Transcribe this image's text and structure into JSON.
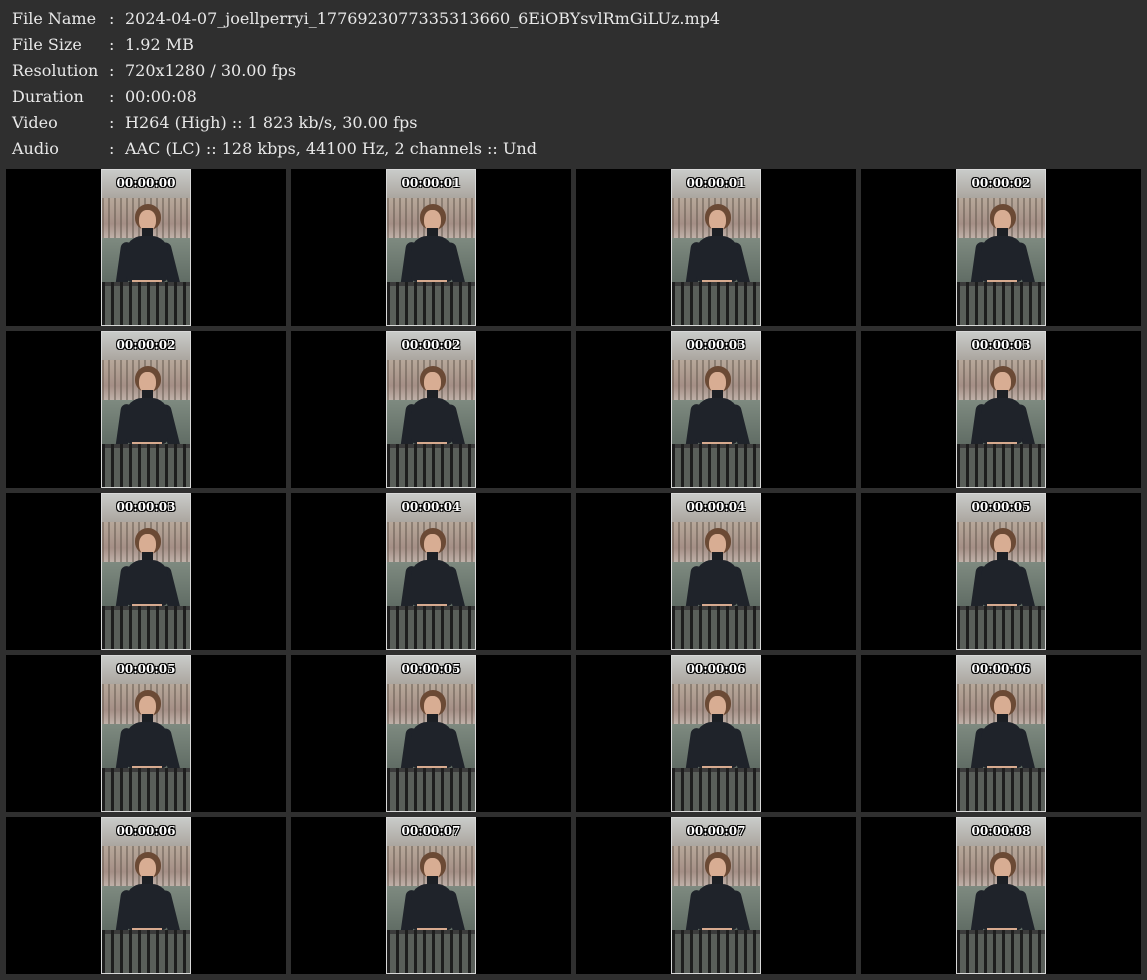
{
  "info": [
    {
      "label": "File Name",
      "value": "2024-04-07_joellperryi_1776923077335313660_6EiOBYsvlRmGiLUz.mp4"
    },
    {
      "label": "File Size",
      "value": "1.92 MB"
    },
    {
      "label": "Resolution",
      "value": "720x1280 / 30.00 fps"
    },
    {
      "label": "Duration",
      "value": "00:00:08"
    },
    {
      "label": "Video",
      "value": "H264 (High) :: 1 823 kb/s, 30.00 fps"
    },
    {
      "label": "Audio",
      "value": "AAC (LC) :: 128 kbps, 44100 Hz, 2 channels :: Und"
    }
  ],
  "colon": ":",
  "thumbnails": [
    {
      "timestamp": "00:00:00"
    },
    {
      "timestamp": "00:00:01"
    },
    {
      "timestamp": "00:00:01"
    },
    {
      "timestamp": "00:00:02"
    },
    {
      "timestamp": "00:00:02"
    },
    {
      "timestamp": "00:00:02"
    },
    {
      "timestamp": "00:00:03"
    },
    {
      "timestamp": "00:00:03"
    },
    {
      "timestamp": "00:00:03"
    },
    {
      "timestamp": "00:00:04"
    },
    {
      "timestamp": "00:00:04"
    },
    {
      "timestamp": "00:00:05"
    },
    {
      "timestamp": "00:00:05"
    },
    {
      "timestamp": "00:00:05"
    },
    {
      "timestamp": "00:00:06"
    },
    {
      "timestamp": "00:00:06"
    },
    {
      "timestamp": "00:00:06"
    },
    {
      "timestamp": "00:00:07"
    },
    {
      "timestamp": "00:00:07"
    },
    {
      "timestamp": "00:00:08"
    }
  ]
}
